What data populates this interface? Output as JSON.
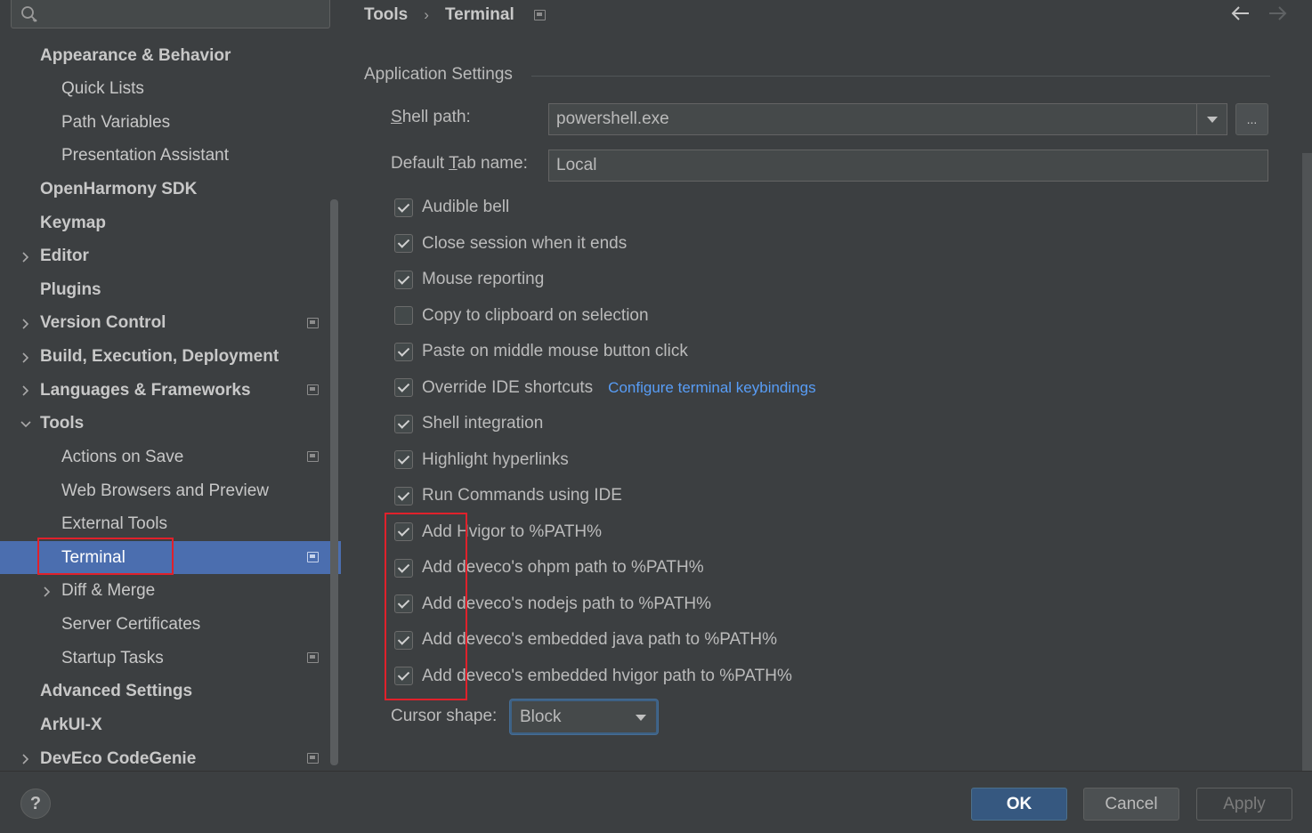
{
  "sidebar": {
    "search": {
      "placeholder": ""
    },
    "items": [
      {
        "label": "Appearance & Behavior",
        "level": 0,
        "bold": true,
        "expander": "none",
        "project_icon": false,
        "selected": false
      },
      {
        "label": "Quick Lists",
        "level": 1,
        "bold": false,
        "expander": "none",
        "project_icon": false,
        "selected": false
      },
      {
        "label": "Path Variables",
        "level": 1,
        "bold": false,
        "expander": "none",
        "project_icon": false,
        "selected": false
      },
      {
        "label": "Presentation Assistant",
        "level": 1,
        "bold": false,
        "expander": "none",
        "project_icon": false,
        "selected": false
      },
      {
        "label": "OpenHarmony SDK",
        "level": 0,
        "bold": true,
        "expander": "none",
        "project_icon": false,
        "selected": false
      },
      {
        "label": "Keymap",
        "level": 0,
        "bold": true,
        "expander": "none",
        "project_icon": false,
        "selected": false
      },
      {
        "label": "Editor",
        "level": 0,
        "bold": true,
        "expander": "collapsed",
        "project_icon": false,
        "selected": false
      },
      {
        "label": "Plugins",
        "level": 0,
        "bold": true,
        "expander": "none",
        "project_icon": false,
        "selected": false
      },
      {
        "label": "Version Control",
        "level": 0,
        "bold": true,
        "expander": "collapsed",
        "project_icon": true,
        "selected": false
      },
      {
        "label": "Build, Execution, Deployment",
        "level": 0,
        "bold": true,
        "expander": "collapsed",
        "project_icon": false,
        "selected": false
      },
      {
        "label": "Languages & Frameworks",
        "level": 0,
        "bold": true,
        "expander": "collapsed",
        "project_icon": true,
        "selected": false
      },
      {
        "label": "Tools",
        "level": 0,
        "bold": true,
        "expander": "expanded",
        "project_icon": false,
        "selected": false
      },
      {
        "label": "Actions on Save",
        "level": 1,
        "bold": false,
        "expander": "none",
        "project_icon": true,
        "selected": false
      },
      {
        "label": "Web Browsers and Preview",
        "level": 1,
        "bold": false,
        "expander": "none",
        "project_icon": false,
        "selected": false
      },
      {
        "label": "External Tools",
        "level": 1,
        "bold": false,
        "expander": "none",
        "project_icon": false,
        "selected": false
      },
      {
        "label": "Terminal",
        "level": 1,
        "bold": false,
        "expander": "none",
        "project_icon": true,
        "selected": true
      },
      {
        "label": "Diff & Merge",
        "level": 1,
        "bold": false,
        "expander": "collapsed",
        "project_icon": false,
        "selected": false
      },
      {
        "label": "Server Certificates",
        "level": 1,
        "bold": false,
        "expander": "none",
        "project_icon": false,
        "selected": false
      },
      {
        "label": "Startup Tasks",
        "level": 1,
        "bold": false,
        "expander": "none",
        "project_icon": true,
        "selected": false
      },
      {
        "label": "Advanced Settings",
        "level": 0,
        "bold": true,
        "expander": "none",
        "project_icon": false,
        "selected": false
      },
      {
        "label": "ArkUI-X",
        "level": 0,
        "bold": true,
        "expander": "none",
        "project_icon": false,
        "selected": false
      },
      {
        "label": "DevEco CodeGenie",
        "level": 0,
        "bold": true,
        "expander": "collapsed",
        "project_icon": true,
        "selected": false
      }
    ]
  },
  "breadcrumb": {
    "parent": "Tools",
    "separator": "›",
    "current": "Terminal"
  },
  "section": {
    "title": "Application Settings"
  },
  "fields": {
    "shell_path": {
      "label_pre": "",
      "label_mnemonic": "S",
      "label_post": "hell path:",
      "value": "powershell.exe",
      "browse_label": "..."
    },
    "tab_name": {
      "label_pre": "Default ",
      "label_mnemonic": "T",
      "label_post": "ab name:",
      "value": "Local"
    }
  },
  "options": [
    {
      "label": "Audible bell",
      "checked": true
    },
    {
      "label": "Close session when it ends",
      "checked": true
    },
    {
      "label": "Mouse reporting",
      "checked": true
    },
    {
      "label": "Copy to clipboard on selection",
      "checked": false
    },
    {
      "label": "Paste on middle mouse button click",
      "checked": true
    },
    {
      "label": "Override IDE shortcuts",
      "checked": true,
      "link": "Configure terminal keybindings"
    },
    {
      "label": "Shell integration",
      "checked": true
    },
    {
      "label": "Highlight hyperlinks",
      "checked": true
    },
    {
      "label": "Run Commands using IDE",
      "checked": true
    },
    {
      "label": "Add Hvigor to %PATH%",
      "checked": true
    },
    {
      "label": "Add deveco's ohpm path to %PATH%",
      "checked": true
    },
    {
      "label": "Add deveco's nodejs path to %PATH%",
      "checked": true
    },
    {
      "label": "Add deveco's embedded java path to %PATH%",
      "checked": true
    },
    {
      "label": "Add deveco's embedded hvigor path to %PATH%",
      "checked": true
    }
  ],
  "cursor_shape": {
    "label": "Cursor shape:",
    "value": "Block"
  },
  "footer": {
    "help_label": "?",
    "ok_label": "OK",
    "cancel_label": "Cancel",
    "apply_label": "Apply"
  },
  "colors": {
    "background": "#3c3f41",
    "selection": "#4b6eaf",
    "link": "#589df6",
    "highlight": "#e0212b",
    "primary_button": "#365880"
  }
}
